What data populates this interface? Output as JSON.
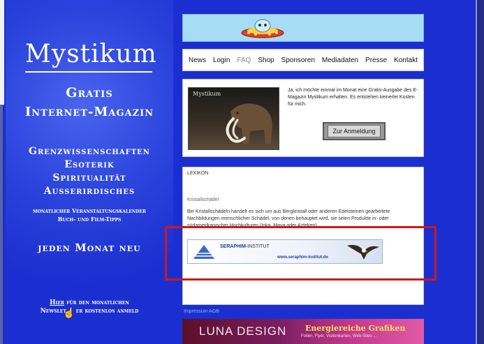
{
  "sidebar": {
    "logo": "Mystikum",
    "gratis": "Gratis",
    "internet": "Internet-Magazin",
    "topics": [
      "Grenzwissenschaften",
      "Esoterik",
      "Spiritualität",
      "Ausserirdisches"
    ],
    "kalender_line1": "monatlicher Veranstaltungskalender",
    "kalender_line2": "Buch- und Film-Tipps",
    "monat": "jeden Monat neu",
    "newsletter_line1_link": "Hier",
    "newsletter_line1_rest": " für den monatlichen",
    "newsletter_line2a": "Newslet",
    "newsletter_line2b": "er kostenlos anmeld"
  },
  "nav": {
    "items": [
      "News",
      "Login",
      "FAQ",
      "Shop",
      "Sponsoren",
      "Mediadaten",
      "Presse",
      "Kontakt"
    ]
  },
  "promo": {
    "cover_title": "Mystikum",
    "text": "Ja, ich möchte einmal im Monat eine Gratis-Ausgabe des E-Magazin Mystikum erhalten. Es entstehen keinerlei Kosten für mich.",
    "button": "Zur Anmeldung"
  },
  "lexikon": {
    "heading": "LEXIKON",
    "title": "Kristallschädel",
    "body": "Bei Kristallschädeln handelt es sich um aus Bergkristall oder anderen Edelsteinen gearbeitete Nachbildungen menschlicher Schädel, von denen behauptet wird, sie seien Produkte in- oder südamerikanischer Hochkulturen (Inka, Maya oder Azteken)"
  },
  "seraphim": {
    "name_bold": "SERAPHIM-",
    "name_rest": "INSTITUT",
    "url": "www.seraphim-institut.de"
  },
  "impressum": "Impressum AGB",
  "luna": {
    "name": "LUNA DESIGN",
    "slogan": "Energiereiche Grafiken",
    "sub": "Folien, Flyer, Visitenkarten, Web-Sites ..."
  },
  "colors": {
    "background": "#1b2fd0",
    "highlight": "#cc1a1a",
    "banner": "#a7dcf5"
  }
}
